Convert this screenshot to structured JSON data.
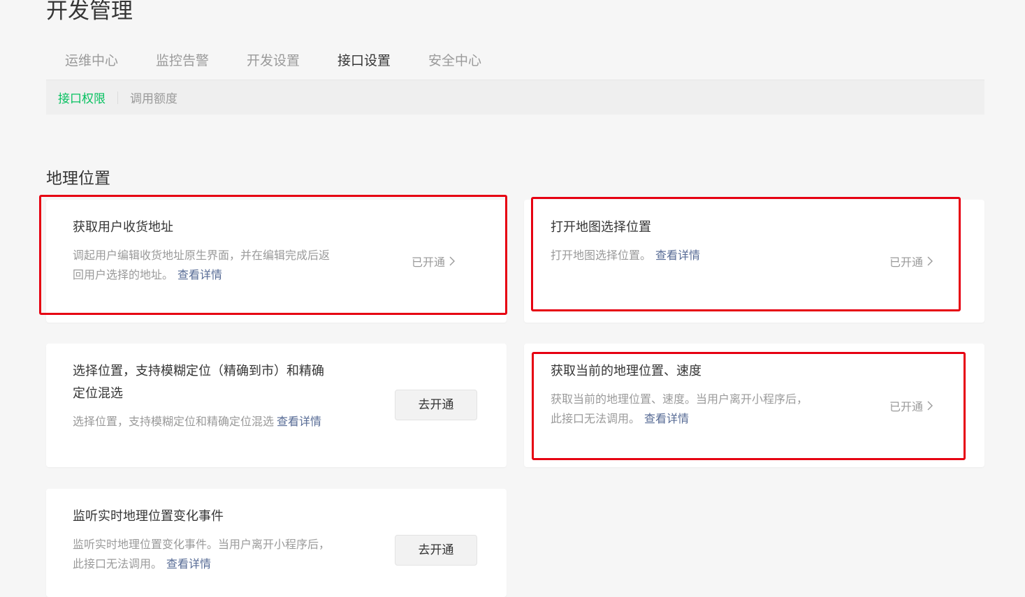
{
  "page": {
    "title": "开发管理"
  },
  "tabs": [
    {
      "label": "运维中心"
    },
    {
      "label": "监控告警"
    },
    {
      "label": "开发设置"
    },
    {
      "label": "接口设置"
    },
    {
      "label": "安全中心"
    }
  ],
  "subnav": [
    {
      "label": "接口权限"
    },
    {
      "label": "调用额度"
    }
  ],
  "section": {
    "title": "地理位置"
  },
  "cards": [
    {
      "title": "获取用户收货地址",
      "desc_line1": "调起用户编辑收货地址原生界面，并在编辑完成后返",
      "desc_line2": "回用户选择的地址。",
      "link": "查看详情",
      "status": "已开通"
    },
    {
      "title": "打开地图选择位置",
      "desc_line1": "打开地图选择位置。",
      "link": "查看详情",
      "status": "已开通"
    },
    {
      "title_line1": "选择位置，支持模糊定位（精确到市）和精确",
      "title_line2": "定位混选",
      "desc_line1": "选择位置，支持模糊定位和精确定位混选",
      "link": "查看详情",
      "button": "去开通"
    },
    {
      "title": "获取当前的地理位置、速度",
      "desc_line1": "获取当前的地理位置、速度。当用户离开小程序后，",
      "desc_line2": "此接口无法调用。",
      "link": "查看详情",
      "status": "已开通"
    },
    {
      "title": "监听实时地理位置变化事件",
      "desc_line1": "监听实时地理位置变化事件。当用户离开小程序后，",
      "desc_line2": "此接口无法调用。",
      "link": "查看详情",
      "button": "去开通"
    }
  ],
  "colors": {
    "accent": "#07c160",
    "link": "#576b95",
    "highlight": "#e60012",
    "background": "#f6f6f6"
  },
  "icons": {
    "status_chevron": "chevron-right-icon"
  }
}
